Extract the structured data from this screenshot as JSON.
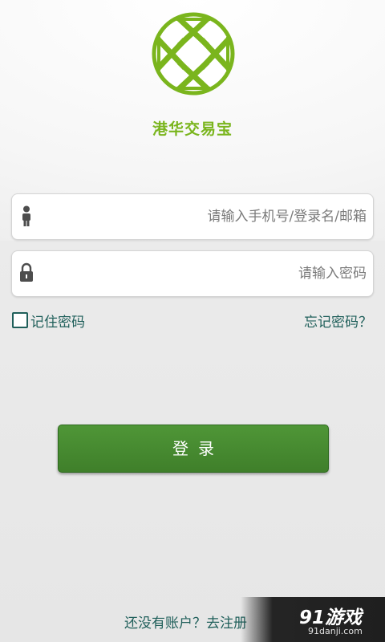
{
  "app": {
    "brand_name": "港华交易宝",
    "brand_color": "#7ab51d",
    "logo_icon": "brand-logo-icon"
  },
  "login_form": {
    "username": {
      "value": "",
      "placeholder": "请输入手机号/登录名/邮箱",
      "icon": "user-icon"
    },
    "password": {
      "value": "",
      "placeholder": "请输入密码",
      "icon": "lock-icon"
    },
    "remember_me": {
      "label": "记住密码",
      "checked": false
    },
    "forgot_password_label": "忘记密码？",
    "login_button_label": "登录",
    "login_button_color": "#4a8f33",
    "register_prompt": "还没有账户？去注册"
  },
  "watermark": {
    "brand": "91游戏",
    "url": "91danji.com"
  }
}
